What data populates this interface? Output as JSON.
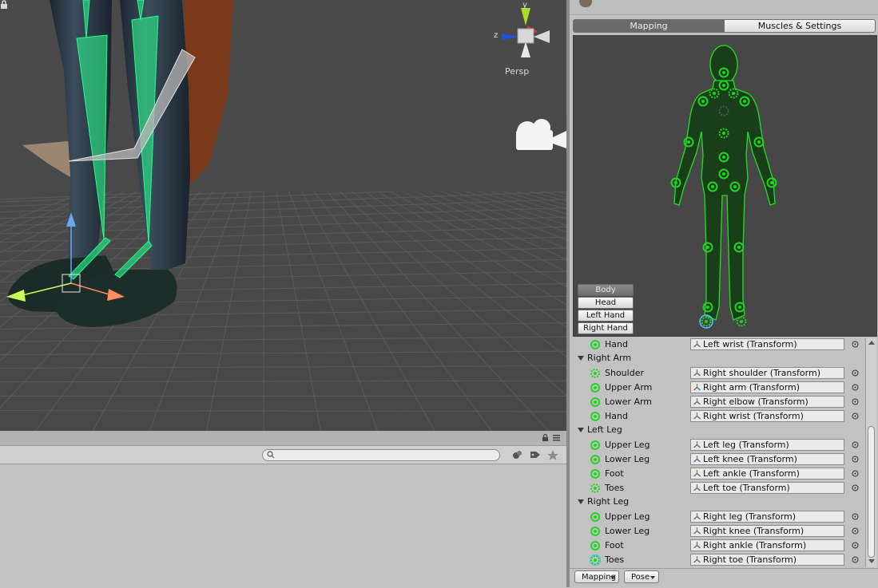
{
  "scene": {
    "persp_label": "Persp",
    "axes": {
      "x": "x",
      "y": "y",
      "z": "z"
    }
  },
  "bottom_panel": {
    "search_placeholder": ""
  },
  "inspector": {
    "tabs": [
      {
        "label": "Mapping",
        "active": true
      },
      {
        "label": "Muscles & Settings",
        "active": false
      }
    ],
    "body_parts": [
      "Body",
      "Head",
      "Left Hand",
      "Right Hand"
    ],
    "active_body_part": "Body",
    "rows": [
      {
        "kind": "bone",
        "label": "Hand",
        "value": "Left wrist (Transform)",
        "optional": false
      },
      {
        "kind": "group",
        "label": "Right Arm"
      },
      {
        "kind": "bone",
        "label": "Shoulder",
        "value": "Right shoulder (Transform)",
        "optional": true
      },
      {
        "kind": "bone",
        "label": "Upper Arm",
        "value": "Right arm (Transform)",
        "optional": false
      },
      {
        "kind": "bone",
        "label": "Lower Arm",
        "value": "Right elbow (Transform)",
        "optional": false
      },
      {
        "kind": "bone",
        "label": "Hand",
        "value": "Right wrist (Transform)",
        "optional": false
      },
      {
        "kind": "group",
        "label": "Left Leg"
      },
      {
        "kind": "bone",
        "label": "Upper Leg",
        "value": "Left leg (Transform)",
        "optional": false
      },
      {
        "kind": "bone",
        "label": "Lower Leg",
        "value": "Left knee (Transform)",
        "optional": false
      },
      {
        "kind": "bone",
        "label": "Foot",
        "value": "Left ankle (Transform)",
        "optional": false
      },
      {
        "kind": "bone",
        "label": "Toes",
        "value": "Left toe (Transform)",
        "optional": true
      },
      {
        "kind": "group",
        "label": "Right Leg"
      },
      {
        "kind": "bone",
        "label": "Upper Leg",
        "value": "Right leg (Transform)",
        "optional": false
      },
      {
        "kind": "bone",
        "label": "Lower Leg",
        "value": "Right knee (Transform)",
        "optional": false
      },
      {
        "kind": "bone",
        "label": "Foot",
        "value": "Right ankle (Transform)",
        "optional": false
      },
      {
        "kind": "bone",
        "label": "Toes",
        "value": "Right toe (Transform)",
        "optional": true,
        "selected": true
      }
    ],
    "footer": {
      "mapping_label": "Mapping",
      "pose_label": "Pose"
    }
  },
  "colors": {
    "bone_green": "#1fd61f",
    "selected_cyan": "#4fc3f7",
    "scene_bg": "#474747"
  },
  "icons": [
    "lock-icon",
    "scene-gizmo",
    "camera-icon",
    "search-icon",
    "transform-icon",
    "object-picker-icon",
    "avatar-icon"
  ]
}
